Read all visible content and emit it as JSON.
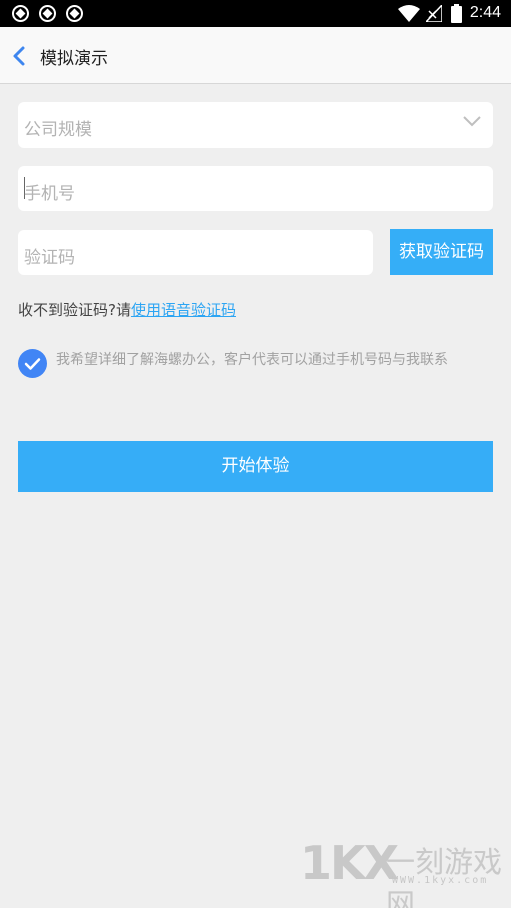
{
  "status_bar": {
    "time": "2:44",
    "icons": [
      "notification-icon",
      "notification-icon",
      "notification-icon",
      "wifi-icon",
      "no-signal-icon",
      "battery-icon"
    ]
  },
  "header": {
    "title": "模拟演示",
    "back_icon": "chevron-left-icon"
  },
  "form": {
    "company_size": {
      "placeholder": "公司规模",
      "icon": "chevron-down-icon"
    },
    "phone": {
      "placeholder": "手机号"
    },
    "code": {
      "placeholder": "验证码"
    },
    "get_code_label": "获取验证码",
    "hint_text": "收不到验证码?请",
    "voice_link": "使用语音验证码",
    "agreement_text": "我希望详细了解海螺办公，客户代表可以通过手机号码与我联系",
    "agreement_checked": true,
    "submit_label": "开始体验"
  },
  "watermark": {
    "logo": "1KX",
    "name": "一刻游戏网",
    "url": "WWW.1kyx.com"
  },
  "colors": {
    "accent": "#36adf7",
    "check": "#4185f5",
    "link": "#2da5f3"
  }
}
